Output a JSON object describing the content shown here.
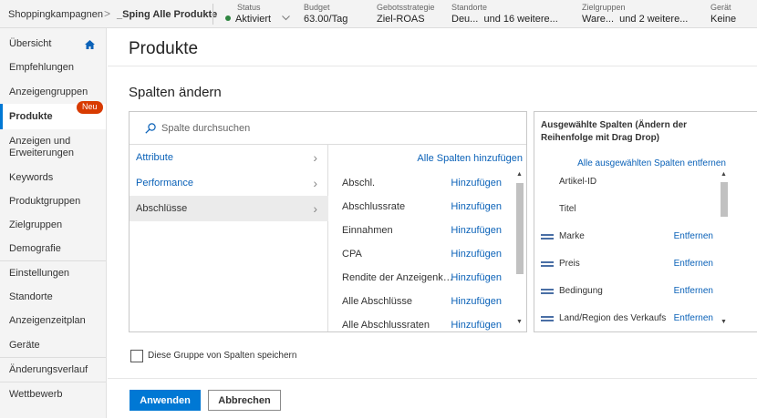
{
  "topbar": {
    "breadcrumb_campaigns": "Shoppingkampagnen",
    "breadcrumb_sep": ">",
    "breadcrumb_campaign": "_Sping Alle Produkte",
    "status": {
      "label": "Status",
      "value": "Aktiviert"
    },
    "budget": {
      "label": "Budget",
      "value": "63.00/Tag"
    },
    "bidstrategy": {
      "label": "Gebotsstrategie",
      "value": "Ziel-ROAS"
    },
    "locations": {
      "label": "Standorte",
      "value": "Deu...  und 16 weitere..."
    },
    "targetgroups": {
      "label": "Zielgruppen",
      "value": "Ware...  und 2 weitere..."
    },
    "device": {
      "label": "Gerät",
      "value": "Keine"
    }
  },
  "sidebar": {
    "items": [
      {
        "label": "Übersicht"
      },
      {
        "label": "Empfehlungen"
      },
      {
        "label": "Anzeigengruppen"
      },
      {
        "label": "Produkte",
        "badge": "Neu"
      },
      {
        "label": "Anzeigen und Erweiterungen"
      },
      {
        "label": "Keywords"
      },
      {
        "label": "Produktgruppen"
      },
      {
        "label": "Zielgruppen"
      },
      {
        "label": "Demografie"
      },
      {
        "label": "Einstellungen"
      },
      {
        "label": "Standorte"
      },
      {
        "label": "Anzeigenzeitplan"
      },
      {
        "label": "Geräte"
      },
      {
        "label": "Änderungsverlauf"
      },
      {
        "label": "Wettbewerb"
      }
    ]
  },
  "main": {
    "page_title": "Produkte",
    "section_title": "Spalten ändern",
    "search_placeholder": "Spalte durchsuchen",
    "categories": [
      {
        "label": "Attribute"
      },
      {
        "label": "Performance"
      },
      {
        "label": "Abschlüsse"
      }
    ],
    "add_all_label": "Alle Spalten hinzufügen",
    "add_label": "Hinzufügen",
    "columns": [
      {
        "name": "Abschl."
      },
      {
        "name": "Abschlussrate"
      },
      {
        "name": "Einnahmen"
      },
      {
        "name": "CPA"
      },
      {
        "name": "Rendite der Anzeigenkosten"
      },
      {
        "name": "Alle Abschlüsse"
      },
      {
        "name": "Alle Abschlussraten"
      }
    ],
    "selected": {
      "title": "Ausgewählte Spalten (Ändern der Reihenfolge mit Drag Drop)",
      "remove_all_label": "Alle ausgewählten Spalten entfernen",
      "remove_label": "Entfernen",
      "items": [
        {
          "name": "Artikel-ID",
          "removable": false
        },
        {
          "name": "Titel",
          "removable": false
        },
        {
          "name": "Marke",
          "removable": true
        },
        {
          "name": "Preis",
          "removable": true
        },
        {
          "name": "Bedingung",
          "removable": true
        },
        {
          "name": "Land/Region des Verkaufs",
          "removable": true
        }
      ]
    },
    "save_group_label": "Diese Gruppe von Spalten speichern",
    "apply_label": "Anwenden",
    "cancel_label": "Abbrechen"
  }
}
